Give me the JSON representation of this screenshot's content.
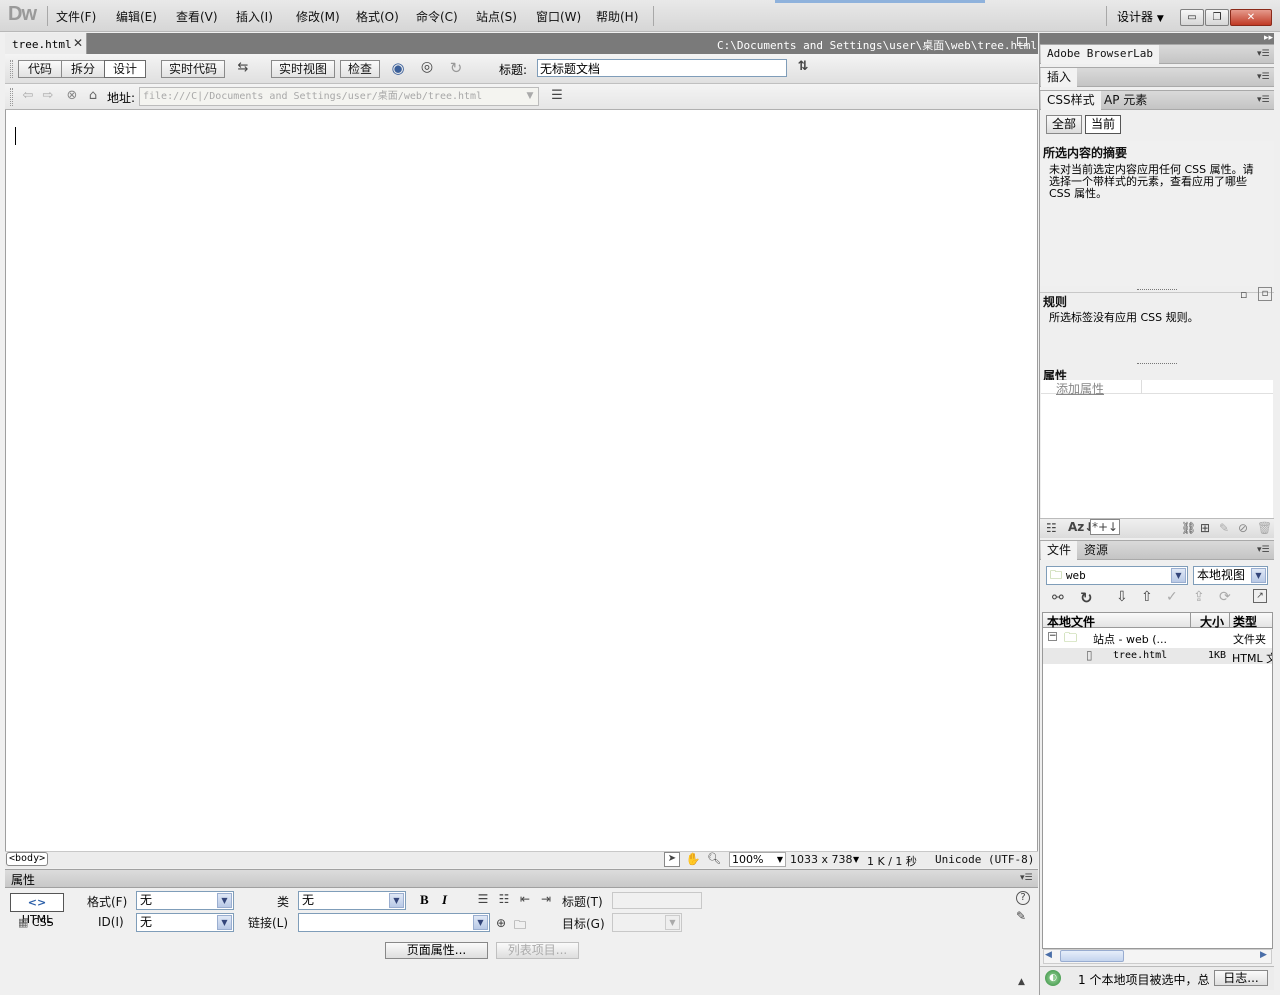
{
  "app": {
    "logo": "Dw",
    "workspace": "设计器"
  },
  "menu": [
    "文件(F)",
    "编辑(E)",
    "查看(V)",
    "插入(I)",
    "修改(M)",
    "格式(O)",
    "命令(C)",
    "站点(S)",
    "窗口(W)",
    "帮助(H)"
  ],
  "window_buttons": {
    "minimize": "▭",
    "restore": "❐",
    "close": "✕"
  },
  "document": {
    "tab_label": "tree.html",
    "path": "C:\\Documents and Settings\\user\\桌面\\web\\tree.html",
    "view_buttons": [
      "代码",
      "拆分",
      "设计"
    ],
    "active_view": "设计",
    "live_code": "实时代码",
    "live_view": "实时视图",
    "inspect": "检查",
    "title_label": "标题:",
    "title_value": "无标题文档",
    "address_label": "地址:",
    "address_value": "file:///C|/Documents and Settings/user/桌面/web/tree.html"
  },
  "statusbar": {
    "tag": "<body>",
    "zoom": "100%",
    "dimensions": "1033 x 738",
    "size": "1 K / 1 秒",
    "encoding": "Unicode (UTF-8)"
  },
  "properties": {
    "header": "属性",
    "html_btn": "HTML",
    "css_btn": "CSS",
    "format_label": "格式(F)",
    "format_value": "无",
    "class_label": "类",
    "class_value": "无",
    "id_label": "ID(I)",
    "id_value": "无",
    "link_label": "链接(L)",
    "title_label": "标题(T)",
    "target_label": "目标(G)",
    "page_props_btn": "页面属性...",
    "list_item_btn": "列表项目...",
    "bold": "B",
    "italic": "I"
  },
  "right_panel": {
    "browserlab": "Adobe BrowserLab",
    "insert": "插入",
    "css_tabs": [
      "CSS样式",
      "AP 元素"
    ],
    "css_mode_buttons": [
      "全部",
      "当前"
    ],
    "active_mode": "当前",
    "summary_title": "所选内容的摘要",
    "summary_text": "未对当前选定内容应用任何 CSS 属性。请选择一个带样式的元素，查看应用了哪些 CSS 属性。",
    "rules_title": "规则",
    "rules_text": "所选标签没有应用 CSS 规则。",
    "attrs_title": "属性",
    "add_attr": "添加属性",
    "files_tabs": [
      "文件",
      "资源"
    ],
    "site_select": "web",
    "view_select": "本地视图",
    "columns": [
      "本地文件",
      "大小",
      "类型"
    ],
    "tree": [
      {
        "name": "站点 - web (...",
        "size": "",
        "type": "文件夹"
      },
      {
        "name": "tree.html",
        "size": "1KB",
        "type": "HTML 文"
      }
    ],
    "status_text": "1 个本地项目被选中，总",
    "log_btn": "日志..."
  }
}
